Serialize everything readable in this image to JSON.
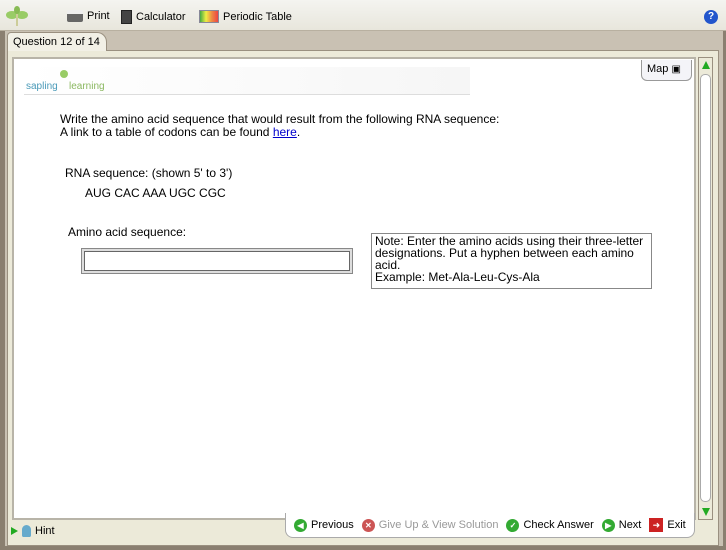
{
  "toolbar": {
    "print": "Print",
    "calculator": "Calculator",
    "periodic_table": "Periodic Table"
  },
  "tab": {
    "label": "Question 12 of 14"
  },
  "logo": {
    "text_left": "sapling",
    "text_right": "learning"
  },
  "map": {
    "label": "Map"
  },
  "question": {
    "line1": "Write the amino acid sequence that would result from the following RNA sequence:",
    "line2_prefix": "A link to a table of codons can be found ",
    "link": "here",
    "line2_suffix": "."
  },
  "rna": {
    "label": "RNA sequence: (shown 5' to 3')",
    "sequence": "AUG CAC AAA UGC CGC"
  },
  "answer": {
    "label": "Amino acid sequence:",
    "value": ""
  },
  "note": {
    "text": "Note: Enter the amino acids using their three-letter designations. Put a hyphen between each amino acid.",
    "example": "Example: Met-Ala-Leu-Cys-Ala"
  },
  "footer": {
    "hint": "Hint",
    "previous": "Previous",
    "give_up": "Give Up & View Solution",
    "check": "Check Answer",
    "next": "Next",
    "exit": "Exit"
  }
}
